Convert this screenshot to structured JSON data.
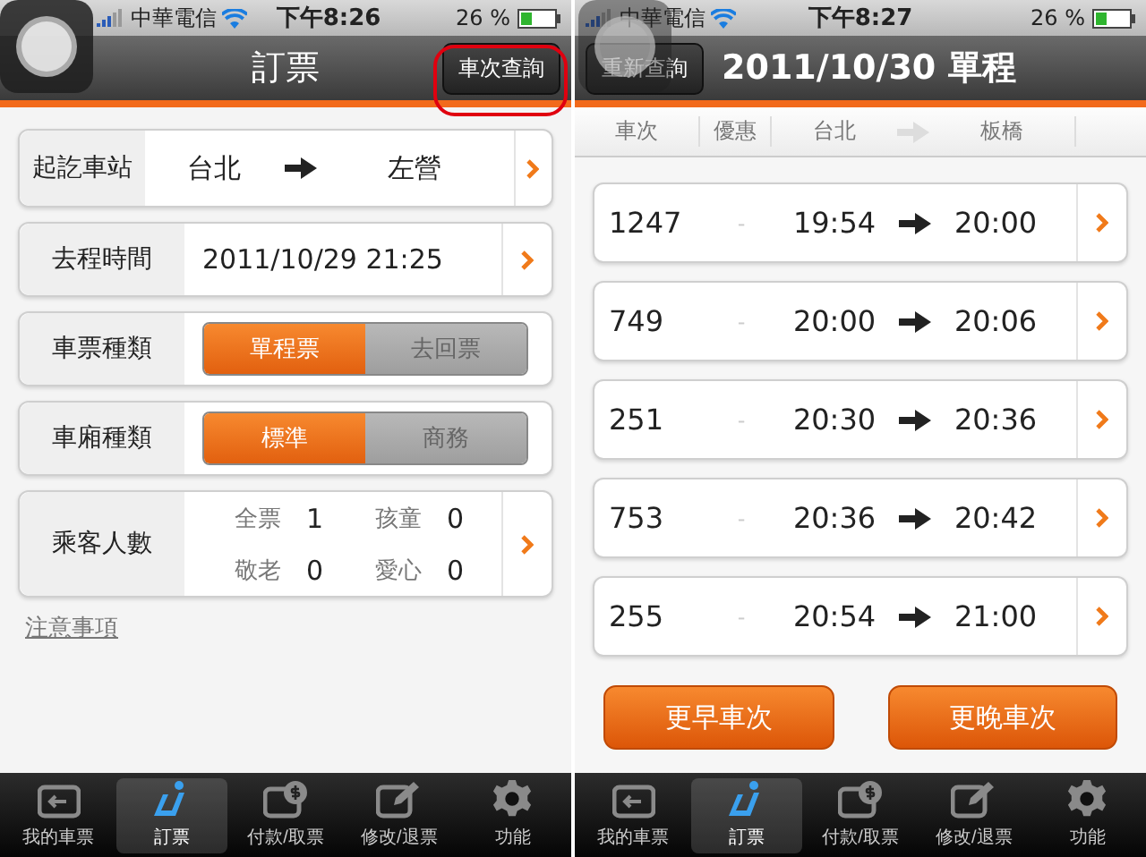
{
  "booking_screen": {
    "status_bar": {
      "carrier": "中華電信",
      "time": "下午8:26",
      "battery": "26 %"
    },
    "nav": {
      "title": "訂票",
      "button": "車次查詢"
    },
    "station": {
      "label": "起訖車站",
      "from": "台北",
      "to": "左營"
    },
    "departure": {
      "label": "去程時間",
      "value": "2011/10/29 21:25"
    },
    "ticket_type": {
      "label": "車票種類",
      "options": [
        {
          "label": "單程票",
          "selected": true
        },
        {
          "label": "去回票",
          "selected": false
        }
      ]
    },
    "car_type": {
      "label": "車廂種類",
      "options": [
        {
          "label": "標準",
          "selected": true
        },
        {
          "label": "商務",
          "selected": false
        }
      ]
    },
    "passengers": {
      "label": "乘客人數",
      "counts": [
        {
          "label": "全票",
          "value": "1"
        },
        {
          "label": "孩童",
          "value": "0"
        },
        {
          "label": "敬老",
          "value": "0"
        },
        {
          "label": "愛心",
          "value": "0"
        }
      ]
    },
    "note_link": "注意事項",
    "tab_bar": [
      {
        "label": "我的車票",
        "selected": false
      },
      {
        "label": "訂票",
        "selected": true
      },
      {
        "label": "付款/取票",
        "selected": false
      },
      {
        "label": "修改/退票",
        "selected": false
      },
      {
        "label": "功能",
        "selected": false
      }
    ]
  },
  "schedule_screen": {
    "status_bar": {
      "carrier": "中華電信",
      "time": "下午8:27",
      "battery": "26 %"
    },
    "nav": {
      "button": "重新查詢",
      "title": "2011/10/30 單程"
    },
    "columns": {
      "train": "車次",
      "discount": "優惠",
      "from": "台北",
      "to": "板橋"
    },
    "trains": [
      {
        "number": "1247",
        "discount": "-",
        "depart": "19:54",
        "arrive": "20:00"
      },
      {
        "number": "749",
        "discount": "-",
        "depart": "20:00",
        "arrive": "20:06"
      },
      {
        "number": "251",
        "discount": "-",
        "depart": "20:30",
        "arrive": "20:36"
      },
      {
        "number": "753",
        "discount": "-",
        "depart": "20:36",
        "arrive": "20:42"
      },
      {
        "number": "255",
        "discount": "-",
        "depart": "20:54",
        "arrive": "21:00"
      }
    ],
    "buttons": [
      "更早車次",
      "更晚車次"
    ],
    "tab_bar": [
      {
        "label": "我的車票",
        "selected": false
      },
      {
        "label": "訂票",
        "selected": true
      },
      {
        "label": "付款/取票",
        "selected": false
      },
      {
        "label": "修改/退票",
        "selected": false
      },
      {
        "label": "功能",
        "selected": false
      }
    ]
  }
}
